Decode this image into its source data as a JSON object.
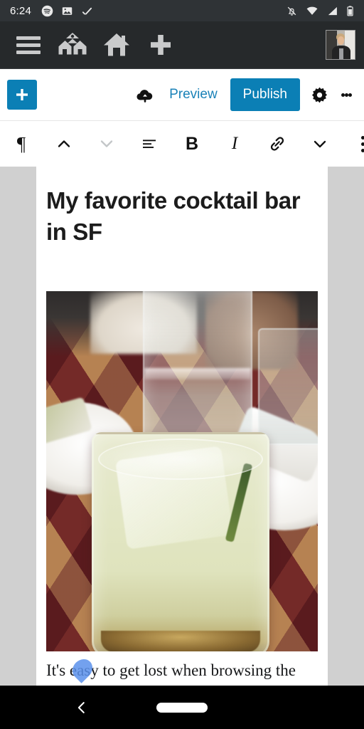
{
  "status_bar": {
    "time": "6:24",
    "left_icons": [
      "spotify-icon",
      "photo-icon",
      "checkmark-icon"
    ],
    "right_icons": [
      "notifications-silenced-icon",
      "wifi-icon",
      "cellular-signal-icon",
      "battery-icon"
    ]
  },
  "app_bar": {
    "menu_label": "hamburger-menu-icon",
    "my_sites_label": "my-sites-icon",
    "reader_label": "home-icon",
    "create_label": "create-post-icon",
    "avatar_label": "account-avatar"
  },
  "editor_bar": {
    "add_block_label": "+",
    "upload_label": "cloud-upload-icon",
    "preview_label": "Preview",
    "publish_label": "Publish",
    "settings_label": "settings-gear-icon",
    "more_label": "more-options-icon"
  },
  "format_bar": {
    "block_type_label": "¶",
    "move_up_label": "move-block-up",
    "move_down_label": "move-block-down",
    "align_label": "align-left",
    "bold_label": "B",
    "italic_label": "I",
    "link_label": "insert-link",
    "more_formats_label": "more-formatting",
    "block_options_label": "block-options"
  },
  "post": {
    "title": "My favorite cocktail bar in SF",
    "image_alt": "Pale green cocktail with a large ice cube on a checkered table",
    "body": "It's easy to get lost when browsing the selection of amazing cocktail"
  },
  "nav_bar": {
    "back_label": "back-button",
    "home_label": "home-gesture-pill"
  },
  "colors": {
    "status_bar_bg": "#2f3336",
    "app_bar_bg": "#26292b",
    "accent_blue": "#0b7fb5",
    "link_blue": "#1a82b8",
    "canvas_gray": "#d0d0d0",
    "cursor_handle": "#5b91eb"
  }
}
